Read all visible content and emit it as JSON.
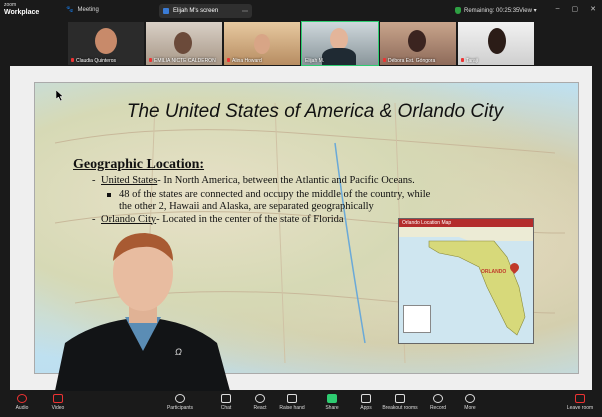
{
  "app": {
    "brand_line1": "zoom",
    "brand_line2": "Workplace"
  },
  "topbar": {
    "meeting_label": "Meeting",
    "share_label": "Elijah M's screen",
    "remaining_label": "Remaining: 00:25:35",
    "view_label": "View"
  },
  "participants": [
    {
      "name": "Claudia Quinteros"
    },
    {
      "name": "EMILIA NICTE CALDERON"
    },
    {
      "name": "Alina Howard"
    },
    {
      "name": "Elijah M."
    },
    {
      "name": "Débora Est. Góngora"
    },
    {
      "name": "Taraji"
    }
  ],
  "slide": {
    "title": "The United States of America & Orlando City",
    "heading": "Geographic Location:",
    "b1_link": "United States",
    "b1_rest": "- In North America, between the Atlantic and Pacific Oceans.",
    "b2": "48 of the states are connected and occupy the middle of the country, while the other 2, Hawaii and Alaska, are separated geographically",
    "b3_link": "Orlando City",
    "b3_rest": "- Located in the center of the state of Florida",
    "inset_title": "Orlando Location Map",
    "inset_city": "ORLANDO"
  },
  "toolbar": [
    {
      "label": "Audio"
    },
    {
      "label": "Video"
    },
    {
      "label": "Participants"
    },
    {
      "label": "Chat"
    },
    {
      "label": "React"
    },
    {
      "label": "Raise hand"
    },
    {
      "label": "Share"
    },
    {
      "label": "Apps"
    },
    {
      "label": "Breakout rooms"
    },
    {
      "label": "Record"
    },
    {
      "label": "More"
    },
    {
      "label": "Leave room"
    }
  ]
}
